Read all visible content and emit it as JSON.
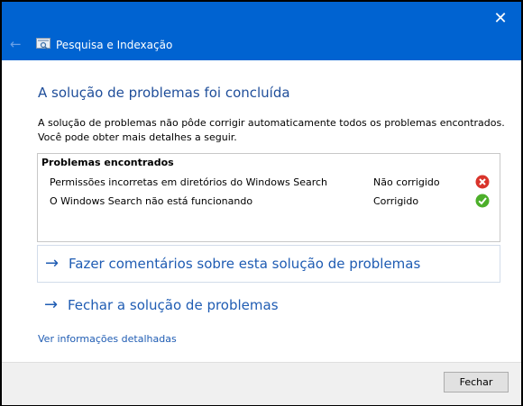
{
  "window": {
    "title": "Pesquisa e Indexação",
    "close_glyph": "✕",
    "back_glyph": "←"
  },
  "main": {
    "heading": "A solução de problemas foi concluída",
    "description": "A solução de problemas não pôde corrigir automaticamente todos os problemas encontrados. Você pode obter mais detalhes a seguir."
  },
  "problems": {
    "title": "Problemas encontrados",
    "rows": [
      {
        "name": "Permissões incorretas em diretórios do Windows Search",
        "status": "Não corrigido",
        "icon": "error-icon"
      },
      {
        "name": "O Windows Search não está funcionando",
        "status": "Corrigido",
        "icon": "check-icon"
      }
    ]
  },
  "actions": {
    "feedback_label": "Fazer comentários sobre esta solução de problemas",
    "close_troubleshooter_label": "Fechar a solução de problemas",
    "arrow_glyph": "→",
    "details_link": "Ver informações detalhadas"
  },
  "footer": {
    "close_button": "Fechar"
  },
  "colors": {
    "titlebar": "#0063d1",
    "link": "#1f5cb3",
    "heading": "#1f4e9a",
    "error": "#d9342b",
    "success": "#4caf2a"
  }
}
